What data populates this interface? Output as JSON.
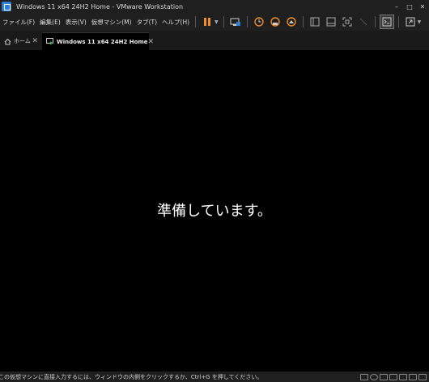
{
  "window": {
    "title": "Windows 11 x64 24H2 Home - VMware Workstation",
    "controls": {
      "minimize": "–",
      "maximize": "□",
      "close": "✕"
    }
  },
  "menu": {
    "file": "ファイル(F)",
    "edit": "編集(E)",
    "view": "表示(V)",
    "vm": "仮想マシン(M)",
    "tabs": "タブ(T)",
    "help": "ヘルプ(H)"
  },
  "toolbar": {
    "icons": [
      "pause-icon",
      "send-ctrl-alt-del-icon",
      "snapshot-icon",
      "revert-snapshot-icon",
      "snapshot-manager-icon",
      "library-icon",
      "thumbnail-bar-icon",
      "full-screen-icon",
      "unity-icon",
      "console-icon",
      "stretch-icon"
    ],
    "accent": "#f08c2a"
  },
  "tabs": [
    {
      "label": "ホーム",
      "icon": "home-icon"
    },
    {
      "label": "Windows 11 x64 24H2 Home",
      "icon": "vm-icon"
    }
  ],
  "vm": {
    "message": "準備しています。"
  },
  "status": {
    "text": "この仮想マシンに直接入力するには、ウィンドウの内側をクリックするか、Ctrl+G を押してください。"
  }
}
